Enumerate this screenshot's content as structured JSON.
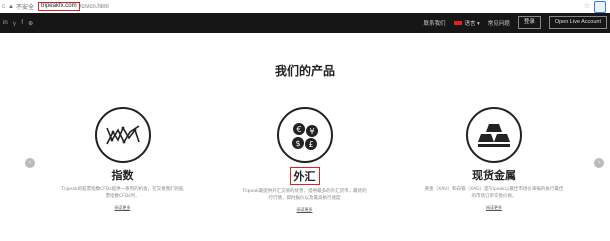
{
  "browser": {
    "warning": "不安全",
    "host": "tripeakfx.com",
    "path": "/cn/cn.html",
    "star": "☆"
  },
  "topbar": {
    "social": [
      "in",
      "𝕪",
      "f",
      "⊕"
    ],
    "contact": "联系我们",
    "language": "语言 ▾",
    "faq": "常见问题",
    "login": "登录",
    "open": "Open Live Account"
  },
  "main": {
    "title": "我们的产品",
    "prev": "‹",
    "next": "›"
  },
  "products": [
    {
      "title": "指数",
      "desc": "Tripeak的股票指数CFDs提供一系列的机会，在交易我们的股票指数CFDs时，",
      "more": "阅读更多"
    },
    {
      "title": "外汇",
      "desc": "Tripeak最提供外汇交易的优势，提供最多的外汇货币，最优的行行情，即时报价以及最高执行速度",
      "more": "阅读更多"
    },
    {
      "title": "现货金属",
      "desc": "黄金（XAU）和白银（XAG）是Tripeak以最佳市场价来报的执行最佳的市场订单交易价格。",
      "more": "阅读更多"
    }
  ]
}
